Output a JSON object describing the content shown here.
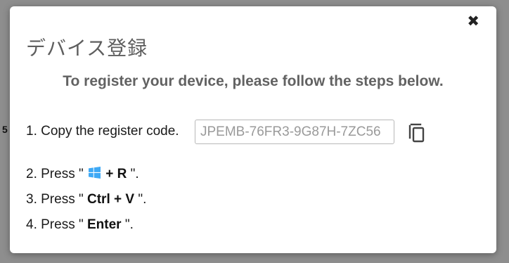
{
  "backdrop": {
    "stray_text": "5"
  },
  "modal": {
    "close_symbol": "✖",
    "title": "デバイス登録",
    "subtitle": "To register your device, please follow the steps below.",
    "steps": {
      "step1": {
        "text": "1. Copy the register code."
      },
      "register_code": "JPEMB-76FR3-9G87H-7ZC56",
      "copy_icon": "copy-icon",
      "step2": {
        "prefix": "2. Press \"",
        "key": "+ R",
        "suffix": "\".",
        "icon": "windows-logo-icon",
        "icon_color": "#3fa9f5"
      },
      "step3": {
        "prefix": "3. Press \"",
        "key": "Ctrl + V",
        "suffix": "\"."
      },
      "step4": {
        "prefix": "4. Press \"",
        "key": "Enter",
        "suffix": "\"."
      }
    }
  }
}
